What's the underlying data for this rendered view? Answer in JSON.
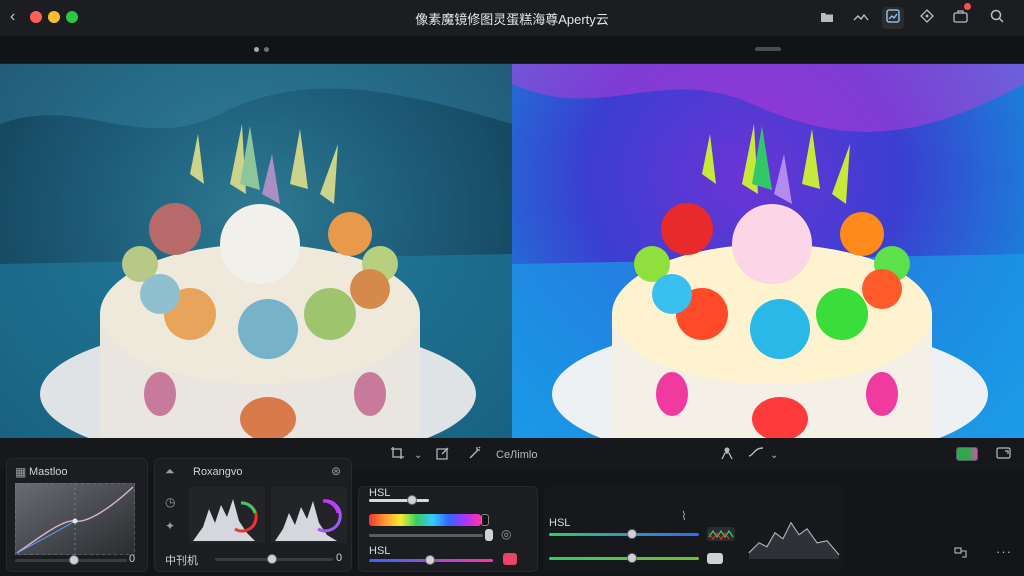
{
  "window": {
    "title": "像素魔镜修图灵蛋糕海尊Aperty云",
    "back_glyph": "‹",
    "traffic_colors": [
      "#ff5f57",
      "#febc2e",
      "#28c840"
    ]
  },
  "toolbar_icons": [
    "folder-icon",
    "compare-icon",
    "image-adjust-icon",
    "effects-icon",
    "export-icon",
    "search-icon"
  ],
  "tools": {
    "crop_label": "",
    "center_label": "CeЛimlo"
  },
  "panels": {
    "curve": {
      "title": "Mastloo",
      "value": "0"
    },
    "histogram": {
      "title": "Roxangvo",
      "slider_label": "中刊机",
      "value": "0"
    },
    "hsl_main": {
      "label_top": "HSL",
      "label_bottom": "HSL"
    },
    "hsl_right": {
      "label": "HSL"
    }
  },
  "colors": {
    "accent_green": "#3fbf4a",
    "accent_blue": "#5fa8ff",
    "accent_purple": "#a855f7",
    "accent_red": "#ff4d4d"
  }
}
